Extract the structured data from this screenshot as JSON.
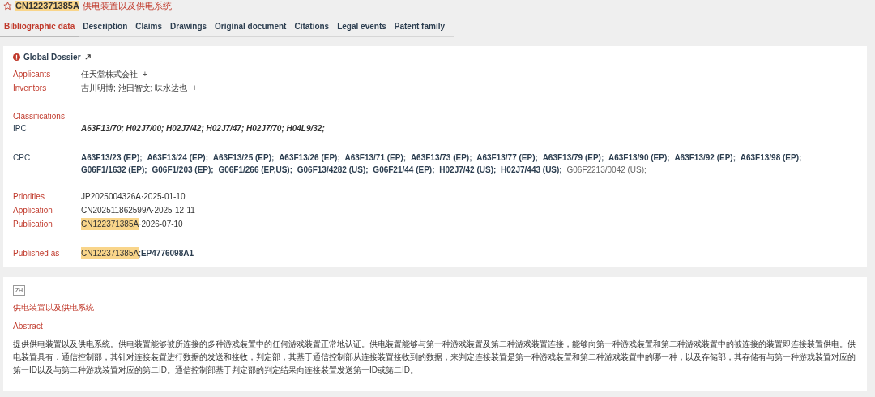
{
  "title": {
    "number": "CN122371385A",
    "name": "供电装置以及供电系统"
  },
  "tabs": [
    {
      "label": "Bibliographic data",
      "selected": true
    },
    {
      "label": "Description",
      "selected": false
    },
    {
      "label": "Claims",
      "selected": false
    },
    {
      "label": "Drawings",
      "selected": false
    },
    {
      "label": "Original document",
      "selected": false
    },
    {
      "label": "Citations",
      "selected": false
    },
    {
      "label": "Legal events",
      "selected": false
    },
    {
      "label": "Patent family",
      "selected": false
    }
  ],
  "dossier": {
    "label": "Global Dossier"
  },
  "parties": [
    {
      "label": "Applicants",
      "names": "任天堂株式会社",
      "more": "+"
    },
    {
      "label": "Inventors",
      "names": "吉川明博; 池田智文; 味水达也",
      "more": "+"
    }
  ],
  "classifications": {
    "heading": "Classifications",
    "ipc": {
      "label": "IPC",
      "codes": "A63F13/70; H02J7/00; H02J7/42; H02J7/47; H02J7/70; H04L9/32;"
    },
    "cpc": {
      "label": "CPC",
      "codes": [
        {
          "code": "A63F13/23 (EP);",
          "kind": "inventive"
        },
        {
          "code": "A63F13/24 (EP);",
          "kind": "inventive"
        },
        {
          "code": "A63F13/25 (EP);",
          "kind": "inventive"
        },
        {
          "code": "A63F13/26 (EP);",
          "kind": "inventive"
        },
        {
          "code": "A63F13/71 (EP);",
          "kind": "inventive"
        },
        {
          "code": "A63F13/73 (EP);",
          "kind": "inventive"
        },
        {
          "code": "A63F13/77 (EP);",
          "kind": "inventive"
        },
        {
          "code": "A63F13/79 (EP);",
          "kind": "inventive"
        },
        {
          "code": "A63F13/90 (EP);",
          "kind": "inventive"
        },
        {
          "code": "A63F13/92 (EP);",
          "kind": "inventive"
        },
        {
          "code": "A63F13/98 (EP);",
          "kind": "inventive"
        },
        {
          "code": "G06F1/1632 (EP);",
          "kind": "inventive"
        },
        {
          "code": "G06F1/203 (EP);",
          "kind": "inventive"
        },
        {
          "code": "G06F1/266 (EP,US);",
          "kind": "inventive"
        },
        {
          "code": "G06F13/4282 (US);",
          "kind": "inventive"
        },
        {
          "code": "G06F21/44 (EP);",
          "kind": "inventive"
        },
        {
          "code": "H02J7/42 (US);",
          "kind": "inventive"
        },
        {
          "code": "H02J7/443 (US);",
          "kind": "inventive"
        },
        {
          "code": "G06F2213/0042 (US);",
          "kind": "additional"
        }
      ]
    }
  },
  "dates": [
    {
      "label": "Priorities",
      "number": "JP2025004326A",
      "highlighted": false,
      "date": "·2025-01-10"
    },
    {
      "label": "Application",
      "number": "CN202511862599A",
      "highlighted": false,
      "date": "·2025-12-11"
    },
    {
      "label": "Publication",
      "number": "CN122371385A",
      "highlighted": true,
      "date": "·2026-07-10"
    }
  ],
  "published_as": {
    "label": "Published as",
    "parts": [
      {
        "text": "CN122371385A",
        "kind": "highlighted"
      },
      {
        "text": ";",
        "kind": "plain"
      },
      {
        "text": "EP4776098A1",
        "kind": "bold"
      }
    ]
  },
  "abstract": {
    "language": "ZH",
    "title": "供电装置以及供电系统",
    "heading": "Abstract",
    "text": "提供供电装置以及供电系统。供电装置能够被所连接的多种游戏装置中的任何游戏装置正常地认证。供电装置能够与第一种游戏装置及第二种游戏装置连接，能够向第一种游戏装置和第二种游戏装置中的被连接的装置即连接装置供电。供电装置具有：通信控制部，其针对连接装置进行数据的发送和接收；判定部，其基于通信控制部从连接装置接收到的数据，来判定连接装置是第一种游戏装置和第二种游戏装置中的哪一种；以及存储部，其存储有与第一种游戏装置对应的第一ID以及与第二种游戏装置对应的第二ID。通信控制部基于判定部的判定结果向连接装置发送第一ID或第二ID。"
  }
}
